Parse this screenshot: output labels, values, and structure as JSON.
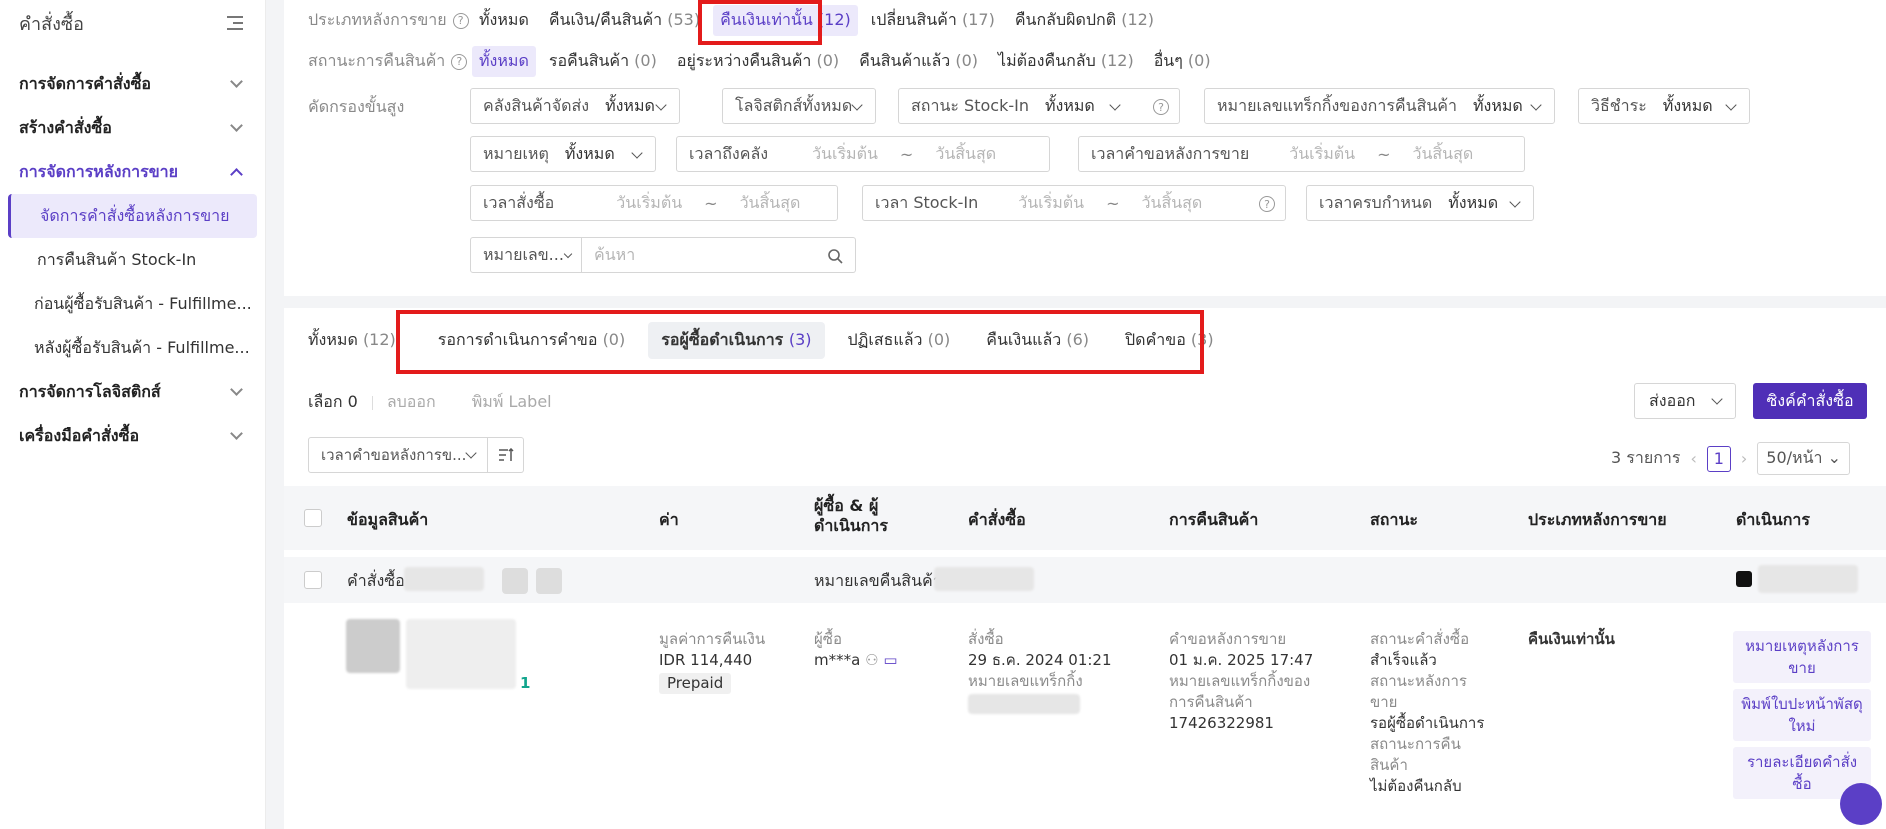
{
  "sidebar": {
    "title": "คำสั่งซื้อ",
    "groups": [
      {
        "label": "การจัดการคำสั่งซื้อ"
      },
      {
        "label": "สร้างคำสั่งซื้อ"
      },
      {
        "label": "การจัดการหลังการขาย"
      },
      {
        "label": "การจัดการโลจิสติกส์"
      },
      {
        "label": "เครื่องมือคำสั่งซื้อ"
      }
    ],
    "items": [
      {
        "label": "จัดการคำสั่งซื้อหลังการขาย"
      },
      {
        "label": "การคืนสินค้า Stock-In"
      },
      {
        "label": "ก่อนผู้ซื้อรับสินค้า - Fulfillme..."
      },
      {
        "label": "หลังผู้ซื้อรับสินค้า - Fulfillme..."
      }
    ]
  },
  "filters": {
    "type_label": "ประเภทหลังการขาย",
    "type_options": [
      {
        "label": "ทั้งหมด",
        "count": ""
      },
      {
        "label": "คืนเงิน/คืนสินค้า",
        "count": "(53)"
      },
      {
        "label": "คืนเงินเท่านั้น",
        "count": "(12)"
      },
      {
        "label": "เปลี่ยนสินค้า",
        "count": "(17)"
      },
      {
        "label": "คืนกลับผิดปกติ",
        "count": "(12)"
      }
    ],
    "status_label": "สถานะการคืนสินค้า",
    "status_options": [
      {
        "label": "ทั้งหมด",
        "count": ""
      },
      {
        "label": "รอคืนสินค้า",
        "count": "(0)"
      },
      {
        "label": "อยู่ระหว่างคืนสินค้า",
        "count": "(0)"
      },
      {
        "label": "คืนสินค้าแล้ว",
        "count": "(0)"
      },
      {
        "label": "ไม่ต้องคืนกลับ",
        "count": "(12)"
      },
      {
        "label": "อื่นๆ",
        "count": "(0)"
      }
    ],
    "advanced_label": "คัดกรองขั้นสูง",
    "warehouse": {
      "label": "คลังสินค้าจัดส่ง",
      "value": "ทั้งหมด"
    },
    "logistics": {
      "label": "โลจิสติกส์ทั้งหมด"
    },
    "stockin": {
      "label": "สถานะ Stock-In",
      "value": "ทั้งหมด"
    },
    "tracking": {
      "label": "หมายเลขแทร็กกิ้งของการคืนสินค้า",
      "value": "ทั้งหมด"
    },
    "payment": {
      "label": "วิธีชำระ",
      "value": "ทั้งหมด"
    },
    "reason": {
      "label": "หมายเหตุ",
      "value": "ทั้งหมด"
    },
    "arrive": {
      "label": "เวลาถึงคลัง",
      "start": "วันเริ่มต้น",
      "end": "วันสิ้นสุด"
    },
    "request_time": {
      "label": "เวลาคำขอหลังการขาย",
      "start": "วันเริ่มต้น",
      "end": "วันสิ้นสุด"
    },
    "order_time": {
      "label": "เวลาสั่งซื้อ",
      "start": "วันเริ่มต้น",
      "end": "วันสิ้นสุด"
    },
    "stockin_time": {
      "label": "เวลา Stock-In",
      "start": "วันเริ่มต้น",
      "end": "วันสิ้นสุด"
    },
    "due_time": {
      "label": "เวลาครบกำหนด",
      "value": "ทั้งหมด"
    },
    "search": {
      "field": "หมายเลข...",
      "placeholder": "ค้นหา"
    }
  },
  "tabs": [
    {
      "label": "ทั้งหมด",
      "count": "(12)"
    },
    {
      "label": "รอการดำเนินการคำขอ",
      "count": "(0)"
    },
    {
      "label": "รอผู้ซื้อดำเนินการ",
      "count": "(3)"
    },
    {
      "label": "ปฏิเสธแล้ว",
      "count": "(0)"
    },
    {
      "label": "คืนเงินแล้ว",
      "count": "(6)"
    },
    {
      "label": "ปิดคำขอ",
      "count": "(3)"
    }
  ],
  "toolbar": {
    "selected": "เลือก 0",
    "delete": "ลบออก",
    "print": "พิมพ์ Label",
    "export": "ส่งออก",
    "sync": "ซิงค์คำสั่งซื้อ"
  },
  "sort": {
    "value": "เวลาคำขอหลังการข..."
  },
  "pager": {
    "total": "3 รายการ",
    "page": "1",
    "size": "50/หน้า"
  },
  "table": {
    "headers": [
      "ข้อมูลสินค้า",
      "ค่า",
      "ผู้ซื้อ & ผู้ดำเนินการ",
      "คำสั่งซื้อ",
      "การคืนสินค้า",
      "สถานะ",
      "ประเภทหลังการขาย",
      "ดำเนินการ"
    ],
    "order_prefix": "คำสั่งซื้อ",
    "return_prefix": "หมายเลขคืนสินค้า",
    "row": {
      "qty": "1",
      "refund_label": "มูลค่าการคืนเงิน",
      "refund_value": "IDR 114,440",
      "pay_badge": "Prepaid",
      "buyer_label": "ผู้ซื้อ",
      "buyer": "m***a",
      "order_label": "สั่งซื้อ",
      "order_time": "29 ธ.ค. 2024 01:21",
      "tracking_label": "หมายเลขแทร็กกิ้ง",
      "req_label": "คำขอหลังการขาย",
      "req_time": "01 ม.ค. 2025 17:47",
      "return_track_label": "หมายเลขแทร็กกิ้งของการคืนสินค้า",
      "return_track": "17426322981",
      "st1_label": "สถานะคำสั่งซื้อ",
      "st1": "สำเร็จแล้ว",
      "st2_label": "สถานะหลังการขาย",
      "st2": "รอผู้ซื้อดำเนินการ",
      "st3_label": "สถานะการคืนสินค้า",
      "st3": "ไม่ต้องคืนกลับ",
      "type": "คืนเงินเท่านั้น",
      "actions": [
        "หมายเหตุหลังการขาย",
        "พิมพ์ใบปะหน้าพัสดุใหม่",
        "รายละเอียดคำสั่งซื้อ"
      ]
    }
  },
  "colors": {
    "accent": "#5b3fc6",
    "highlight": "#e31b1b"
  }
}
